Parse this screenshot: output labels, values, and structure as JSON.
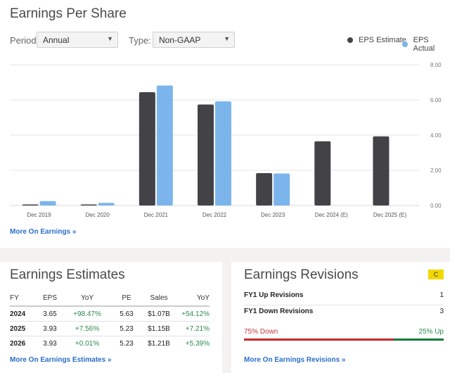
{
  "eps": {
    "title": "Earnings Per Share",
    "period_label": "Period:",
    "period_value": "Annual",
    "type_label": "Type:",
    "type_value": "Non-GAAP",
    "more_link": "More On Earnings »"
  },
  "chart_data": {
    "type": "bar",
    "title": "Earnings Per Share",
    "xlabel": "",
    "ylabel": "",
    "categories": [
      "Dec 2019",
      "Dec 2020",
      "Dec 2021",
      "Dec 2022",
      "Dec 2023",
      "Dec 2024 (E)",
      "Dec 2025 (E)"
    ],
    "series": [
      {
        "name": "EPS Estimate",
        "color": "#434247",
        "values": [
          0.06,
          0.06,
          6.44,
          5.74,
          1.84,
          3.65,
          3.93
        ]
      },
      {
        "name": "EPS Actual",
        "color": "#7cb5ec",
        "values": [
          0.25,
          0.15,
          6.82,
          5.92,
          1.82,
          null,
          null
        ]
      }
    ],
    "ylim": [
      0,
      8
    ],
    "yticks": [
      "0.00",
      "2.00",
      "4.00",
      "6.00",
      "8.00"
    ],
    "ytick_values": [
      0,
      2,
      4,
      6,
      8
    ],
    "y_axis_side": "right",
    "grid": true,
    "legend_position": "top-right"
  },
  "estimates": {
    "title": "Earnings Estimates",
    "headers": [
      "FY",
      "EPS",
      "YoY",
      "PE",
      "Sales",
      "YoY"
    ],
    "rows": [
      [
        "2024",
        "3.65",
        "+98.47%",
        "5.63",
        "$1.07B",
        "+54.12%"
      ],
      [
        "2025",
        "3.93",
        "+7.56%",
        "5.23",
        "$1.15B",
        "+7.21%"
      ],
      [
        "2026",
        "3.93",
        "+0.01%",
        "5.23",
        "$1.21B",
        "+5.39%"
      ]
    ],
    "more_link": "More On Earnings Estimates »"
  },
  "revisions": {
    "title": "Earnings Revisions",
    "grade": "C",
    "grade_color": "#f2d800",
    "up_label": "FY1 Up Revisions",
    "up_value": "1",
    "down_label": "FY1 Down Revisions",
    "down_value": "3",
    "down_pct_label": "75% Down",
    "up_pct_label": "25% Up",
    "down_fraction": 0.75,
    "up_fraction": 0.25,
    "more_link": "More On Earnings Revisions »"
  }
}
